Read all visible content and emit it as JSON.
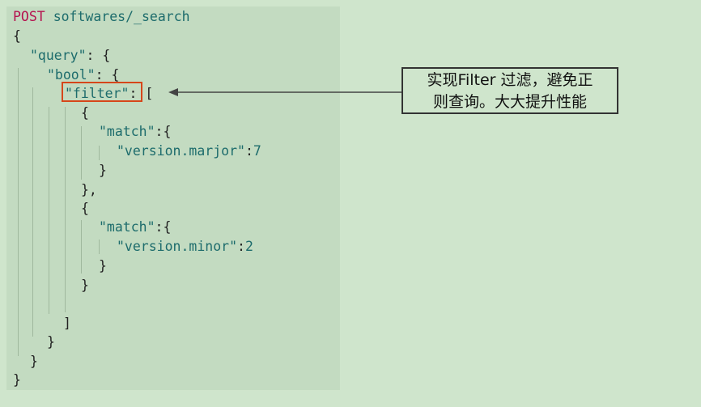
{
  "request": {
    "method": "POST",
    "path": "softwares/_search"
  },
  "code": {
    "query_key": "\"query\"",
    "bool_key": "\"bool\"",
    "filter_key": "\"filter\"",
    "match_key_1": "\"match\"",
    "field_1": "\"version.marjor\"",
    "value_1": "7",
    "match_key_2": "\"match\"",
    "field_2": "\"version.minor\"",
    "value_2": "2"
  },
  "callout": {
    "line1": "实现Filter 过滤，避免正",
    "line2": "则查询。大大提升性能"
  },
  "colors": {
    "background": "#cfe5cc",
    "code_panel": "#c3dbc1",
    "highlight_border": "#d6461a",
    "method": "#b5134f",
    "token": "#1d6c6c"
  }
}
